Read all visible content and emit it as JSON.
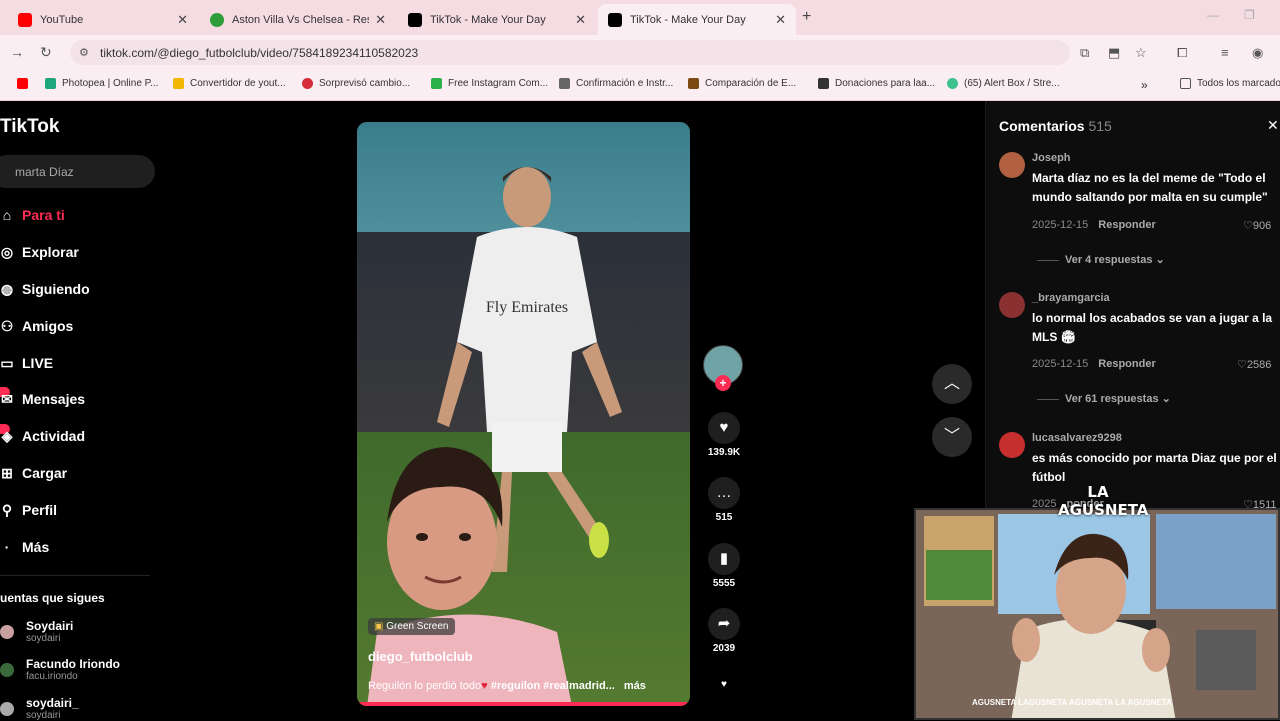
{
  "browser": {
    "tabs": [
      {
        "title": "YouTube",
        "icon": "youtube-icon",
        "color": "#ff0000"
      },
      {
        "title": "Aston Villa Vs Chelsea - Resulta",
        "icon": "football-icon",
        "color": "#2e9d3a"
      },
      {
        "title": "TikTok - Make Your Day",
        "icon": "tiktok-icon",
        "color": "#000000"
      },
      {
        "title": "TikTok - Make Your Day",
        "icon": "tiktok-icon",
        "color": "#000000"
      }
    ],
    "url": "tiktok.com/@diego_futbolclub/video/7584189234110582023",
    "bookmarks": [
      {
        "label": "Photopea | Online P...",
        "color": "#1fa67a"
      },
      {
        "label": "Convertidor de yout...",
        "color": "#f2b705"
      },
      {
        "label": "Sorprevisó cambio...",
        "color": "#d62b3a"
      },
      {
        "label": "Free Instagram Com...",
        "color": "#2bb34a"
      },
      {
        "label": "Confirmación e Instr...",
        "color": "#666666"
      },
      {
        "label": "Comparación de E...",
        "color": "#7a4a10"
      },
      {
        "label": "Donaciones para laa...",
        "color": "#333333"
      },
      {
        "label": "(65) Alert Box / Stre...",
        "color": "#3ec18e"
      }
    ],
    "bookmarks_all": "Todos los marcado"
  },
  "tiktok": {
    "logo": "TikTok",
    "search_value": "marta Díaz",
    "nav": [
      {
        "label": "Para ti",
        "icon": "home-icon"
      },
      {
        "label": "Explorar",
        "icon": "compass-icon"
      },
      {
        "label": "Siguiendo",
        "icon": "following-icon"
      },
      {
        "label": "Amigos",
        "icon": "friends-icon"
      },
      {
        "label": "LIVE",
        "icon": "live-icon"
      },
      {
        "label": "Mensajes",
        "icon": "messages-icon"
      },
      {
        "label": "Actividad",
        "icon": "activity-icon"
      },
      {
        "label": "Cargar",
        "icon": "upload-icon"
      },
      {
        "label": "Perfil",
        "icon": "profile-icon"
      },
      {
        "label": "Más",
        "icon": "more-icon"
      }
    ],
    "following_title": "uentas que sigues",
    "following": [
      {
        "name": "Soydairi",
        "handle": "soydairi",
        "color": "#c9a0a0"
      },
      {
        "name": "Facundo Iriondo",
        "handle": "facu.iriondo",
        "color": "#3a6a3a"
      },
      {
        "name": "soydairi_",
        "handle": "soydairi",
        "color": "#aaaaaa"
      }
    ],
    "video": {
      "badge": "Green Screen",
      "username": "diego_futbolclub",
      "caption": "Reguilón lo perdió todo",
      "tags": "#reguilon #realmadrid...",
      "more": "más",
      "jersey_text": "Fly Emirates"
    },
    "actions": {
      "likes": "139.9K",
      "comments": "515",
      "saves": "5555",
      "shares": "2039"
    },
    "comments_panel": {
      "title": "Comentarios",
      "count": "515",
      "comments": [
        {
          "user": "Joseph",
          "text": "Marta díaz no es la del meme de \"Todo el mundo saltando por malta en su cumple\"",
          "date": "2025-12-15",
          "reply": "Responder",
          "likes": "906",
          "more": "Ver 4 respuestas",
          "color": "#b06040"
        },
        {
          "user": "_brayamgarcia",
          "text": "lo normal los acabados se van a jugar a la MLS 🏟",
          "date": "2025-12-15",
          "reply": "Responder",
          "likes": "2586",
          "more": "Ver 61 respuestas",
          "color": "#8a3030"
        },
        {
          "user": "lucasalvarez9298",
          "text": "es más conocido por marta Diaz que por el fútbol",
          "date": "2025",
          "reply": "ponder",
          "likes": "1511",
          "more": "",
          "color": "#c83030"
        }
      ]
    }
  },
  "webcam": {
    "logo": "LA AGUSNETA",
    "social": "AGUSNETA  LAGUSNETA  AGUSNETA  LA AGUSNETA"
  }
}
